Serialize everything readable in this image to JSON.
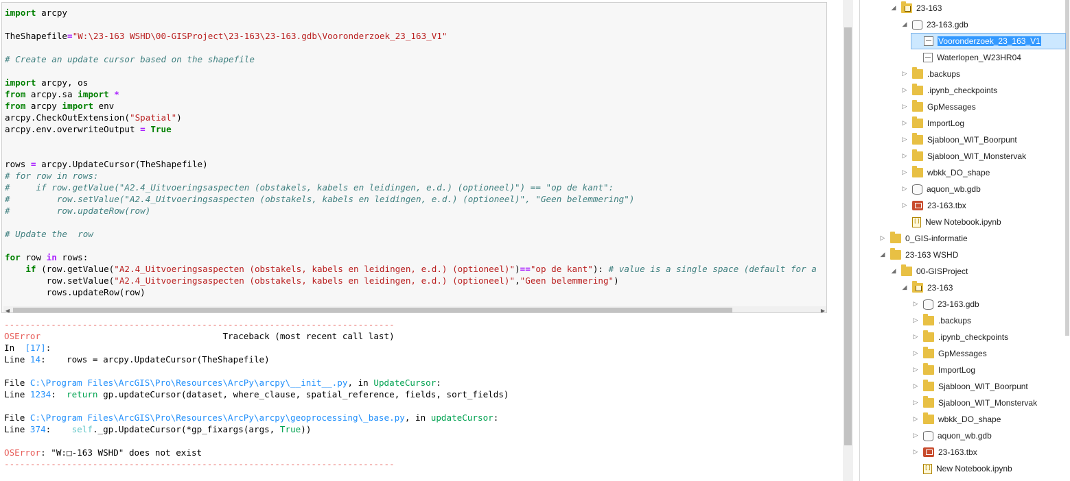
{
  "code_cell": {
    "lines": [
      [
        {
          "t": "import",
          "c": "kw"
        },
        {
          "t": " arcpy",
          "c": ""
        }
      ],
      [],
      [
        {
          "t": "TheShapefile",
          "c": ""
        },
        {
          "t": "=",
          "c": "op"
        },
        {
          "t": "\"W:\\23-163 WSHD\\00-GISProject\\23-163\\23-163.gdb\\Vooronderzoek_23_163_V1\"",
          "c": "st"
        }
      ],
      [],
      [
        {
          "t": "# Create an update cursor based on the shapefile",
          "c": "cm"
        }
      ],
      [],
      [
        {
          "t": "import",
          "c": "kw"
        },
        {
          "t": " arcpy, os",
          "c": ""
        }
      ],
      [
        {
          "t": "from",
          "c": "kw"
        },
        {
          "t": " arcpy.sa ",
          "c": ""
        },
        {
          "t": "import",
          "c": "kw"
        },
        {
          "t": " ",
          "c": ""
        },
        {
          "t": "*",
          "c": "op"
        }
      ],
      [
        {
          "t": "from",
          "c": "kw"
        },
        {
          "t": " arcpy ",
          "c": ""
        },
        {
          "t": "import",
          "c": "kw"
        },
        {
          "t": " env",
          "c": ""
        }
      ],
      [
        {
          "t": "arcpy.CheckOutExtension(",
          "c": ""
        },
        {
          "t": "\"Spatial\"",
          "c": "st"
        },
        {
          "t": ")",
          "c": ""
        }
      ],
      [
        {
          "t": "arcpy.env.overwriteOutput ",
          "c": ""
        },
        {
          "t": "=",
          "c": "op"
        },
        {
          "t": " ",
          "c": ""
        },
        {
          "t": "True",
          "c": "kw"
        }
      ],
      [],
      [],
      [
        {
          "t": "rows ",
          "c": ""
        },
        {
          "t": "=",
          "c": "op"
        },
        {
          "t": " arcpy.UpdateCursor(TheShapefile)",
          "c": ""
        }
      ],
      [
        {
          "t": "# for row in rows:",
          "c": "cm"
        }
      ],
      [
        {
          "t": "#     if row.getValue(\"A2.4_Uitvoeringsaspecten (obstakels, kabels en leidingen, e.d.) (optioneel)\") == \"op de kant\":",
          "c": "cm"
        }
      ],
      [
        {
          "t": "#         row.setValue(\"A2.4_Uitvoeringsaspecten (obstakels, kabels en leidingen, e.d.) (optioneel)\", \"Geen belemmering\")",
          "c": "cm"
        }
      ],
      [
        {
          "t": "#         row.updateRow(row)",
          "c": "cm"
        }
      ],
      [],
      [
        {
          "t": "# Update the  row",
          "c": "cm"
        }
      ],
      [],
      [
        {
          "t": "for",
          "c": "kw"
        },
        {
          "t": " row ",
          "c": ""
        },
        {
          "t": "in",
          "c": "op"
        },
        {
          "t": " rows:",
          "c": ""
        }
      ],
      [
        {
          "t": "    ",
          "c": ""
        },
        {
          "t": "if",
          "c": "kw"
        },
        {
          "t": " (row.getValue(",
          "c": ""
        },
        {
          "t": "\"A2.4_Uitvoeringsaspecten (obstakels, kabels en leidingen, e.d.) (optioneel)\"",
          "c": "st"
        },
        {
          "t": ")",
          "c": ""
        },
        {
          "t": "==",
          "c": "op"
        },
        {
          "t": "\"op de kant\"",
          "c": "st"
        },
        {
          "t": "): ",
          "c": ""
        },
        {
          "t": "# value is a single space (default for a",
          "c": "cm"
        }
      ],
      [
        {
          "t": "        row.setValue(",
          "c": ""
        },
        {
          "t": "\"A2.4_Uitvoeringsaspecten (obstakels, kabels en leidingen, e.d.) (optioneel)\"",
          "c": "st"
        },
        {
          "t": ",",
          "c": ""
        },
        {
          "t": "\"Geen belemmering\"",
          "c": "st"
        },
        {
          "t": ")",
          "c": ""
        }
      ],
      [
        {
          "t": "        rows.updateRow(row)",
          "c": ""
        }
      ]
    ]
  },
  "output": {
    "lines": [
      [
        {
          "t": "---------------------------------------------------------------------------",
          "c": "red"
        }
      ],
      [
        {
          "t": "OSError",
          "c": "red"
        },
        {
          "t": "                                   Traceback (most recent call last)",
          "c": ""
        }
      ],
      [
        {
          "t": "In  ",
          "c": ""
        },
        {
          "t": "[17]",
          "c": "blu"
        },
        {
          "t": ":",
          "c": ""
        }
      ],
      [
        {
          "t": "Line ",
          "c": ""
        },
        {
          "t": "14",
          "c": "blu"
        },
        {
          "t": ":    rows = arcpy.UpdateCursor(TheShapefile)",
          "c": ""
        }
      ],
      [],
      [
        {
          "t": "File ",
          "c": ""
        },
        {
          "t": "C:\\Program Files\\ArcGIS\\Pro\\Resources\\ArcPy\\arcpy\\__init__.py",
          "c": "blu"
        },
        {
          "t": ", in ",
          "c": ""
        },
        {
          "t": "UpdateCursor",
          "c": "grn"
        },
        {
          "t": ":",
          "c": ""
        }
      ],
      [
        {
          "t": "Line ",
          "c": ""
        },
        {
          "t": "1234",
          "c": "blu"
        },
        {
          "t": ":  ",
          "c": ""
        },
        {
          "t": "return",
          "c": "grn"
        },
        {
          "t": " gp.updateCursor(dataset, where_clause, spatial_reference, fields, sort_fields)",
          "c": ""
        }
      ],
      [],
      [
        {
          "t": "File ",
          "c": ""
        },
        {
          "t": "C:\\Program Files\\ArcGIS\\Pro\\Resources\\ArcPy\\arcpy\\geoprocessing\\_base.py",
          "c": "blu"
        },
        {
          "t": ", in ",
          "c": ""
        },
        {
          "t": "updateCursor",
          "c": "grn"
        },
        {
          "t": ":",
          "c": ""
        }
      ],
      [
        {
          "t": "Line ",
          "c": ""
        },
        {
          "t": "374",
          "c": "blu"
        },
        {
          "t": ":    ",
          "c": ""
        },
        {
          "t": "self",
          "c": "cyn"
        },
        {
          "t": "._gp.UpdateCursor(*gp_fixargs(args, ",
          "c": ""
        },
        {
          "t": "True",
          "c": "grn"
        },
        {
          "t": "))",
          "c": ""
        }
      ],
      [],
      [
        {
          "t": "OSError",
          "c": "red"
        },
        {
          "t": ": \"W:□-163 WSHD\" does not exist",
          "c": ""
        }
      ],
      [
        {
          "t": "---------------------------------------------------------------------------",
          "c": "red"
        }
      ]
    ]
  },
  "catalog": {
    "items": [
      {
        "label": "23-163",
        "indent": 1,
        "icon": "folder-home",
        "expander": "expanded"
      },
      {
        "label": "23-163.gdb",
        "indent": 2,
        "icon": "gdb",
        "expander": "expanded"
      },
      {
        "label": "Vooronderzoek_23_163_V1",
        "indent": 3,
        "icon": "feature-class",
        "expander": "none",
        "selected": true
      },
      {
        "label": "Waterlopen_W23HR04",
        "indent": 3,
        "icon": "feature-class",
        "expander": "none"
      },
      {
        "label": ".backups",
        "indent": 2,
        "icon": "folder",
        "expander": "collapsed"
      },
      {
        "label": ".ipynb_checkpoints",
        "indent": 2,
        "icon": "folder",
        "expander": "collapsed"
      },
      {
        "label": "GpMessages",
        "indent": 2,
        "icon": "folder",
        "expander": "collapsed"
      },
      {
        "label": "ImportLog",
        "indent": 2,
        "icon": "folder",
        "expander": "collapsed"
      },
      {
        "label": "Sjabloon_WIT_Boorpunt",
        "indent": 2,
        "icon": "folder",
        "expander": "collapsed"
      },
      {
        "label": "Sjabloon_WIT_Monstervak",
        "indent": 2,
        "icon": "folder",
        "expander": "collapsed"
      },
      {
        "label": "wbkk_DO_shape",
        "indent": 2,
        "icon": "folder",
        "expander": "collapsed"
      },
      {
        "label": "aquon_wb.gdb",
        "indent": 2,
        "icon": "gdb",
        "expander": "collapsed"
      },
      {
        "label": "23-163.tbx",
        "indent": 2,
        "icon": "toolbox",
        "expander": "collapsed"
      },
      {
        "label": "New Notebook.ipynb",
        "indent": 2,
        "icon": "notebook",
        "expander": "none"
      },
      {
        "label": "0_GIS-informatie",
        "indent": 0,
        "icon": "folder",
        "expander": "collapsed"
      },
      {
        "label": "23-163 WSHD",
        "indent": 0,
        "icon": "folder",
        "expander": "expanded"
      },
      {
        "label": "00-GISProject",
        "indent": 1,
        "icon": "folder",
        "expander": "expanded"
      },
      {
        "label": "23-163",
        "indent": 2,
        "icon": "folder-home",
        "expander": "expanded"
      },
      {
        "label": "23-163.gdb",
        "indent": 3,
        "icon": "gdb",
        "expander": "collapsed"
      },
      {
        "label": ".backups",
        "indent": 3,
        "icon": "folder",
        "expander": "collapsed"
      },
      {
        "label": ".ipynb_checkpoints",
        "indent": 3,
        "icon": "folder",
        "expander": "collapsed"
      },
      {
        "label": "GpMessages",
        "indent": 3,
        "icon": "folder",
        "expander": "collapsed"
      },
      {
        "label": "ImportLog",
        "indent": 3,
        "icon": "folder",
        "expander": "collapsed"
      },
      {
        "label": "Sjabloon_WIT_Boorpunt",
        "indent": 3,
        "icon": "folder",
        "expander": "collapsed"
      },
      {
        "label": "Sjabloon_WIT_Monstervak",
        "indent": 3,
        "icon": "folder",
        "expander": "collapsed"
      },
      {
        "label": "wbkk_DO_shape",
        "indent": 3,
        "icon": "folder",
        "expander": "collapsed"
      },
      {
        "label": "aquon_wb.gdb",
        "indent": 3,
        "icon": "gdb",
        "expander": "collapsed"
      },
      {
        "label": "23-163.tbx",
        "indent": 3,
        "icon": "toolbox",
        "expander": "collapsed"
      },
      {
        "label": "New Notebook.ipynb",
        "indent": 3,
        "icon": "notebook",
        "expander": "none"
      }
    ]
  }
}
